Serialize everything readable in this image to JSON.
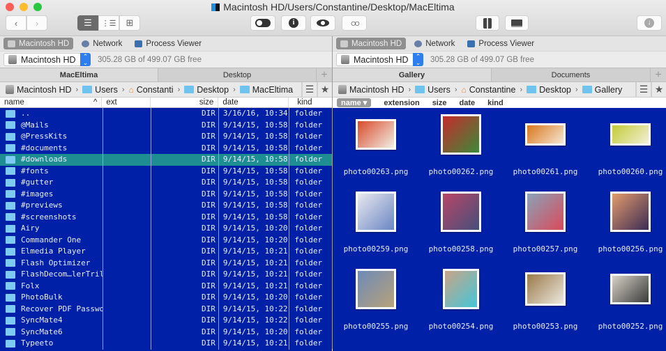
{
  "window": {
    "title": "Macintosh HD/Users/Constantine/Desktop/MacEltima",
    "traffic_lights": {
      "close": "#fc5f57",
      "minimize": "#fdbc2e",
      "zoom": "#28c840"
    }
  },
  "toolbar": {
    "back_icon": "chevron-left",
    "forward_icon": "chevron-right",
    "view_modes": [
      {
        "name": "list-view",
        "glyph": "☰",
        "active": true
      },
      {
        "name": "detail-view",
        "glyph": "⋮☰",
        "active": false
      },
      {
        "name": "grid-view",
        "glyph": "⊞",
        "active": false
      }
    ],
    "buttons": [
      {
        "name": "toggle-hidden",
        "glyph": "toggle"
      },
      {
        "name": "info",
        "glyph": "i"
      },
      {
        "name": "quick-look",
        "glyph": "eye"
      },
      {
        "name": "search",
        "glyph": "binoculars"
      },
      {
        "name": "archive",
        "glyph": "zip"
      },
      {
        "name": "network-share",
        "glyph": "network-folder"
      },
      {
        "name": "download",
        "glyph": "download"
      }
    ]
  },
  "colors": {
    "list_bg": "#0020a8",
    "selection": "#1f8e92",
    "accent": "#2f7ef0"
  },
  "left": {
    "devices": [
      {
        "label": "Macintosh HD",
        "active": true
      },
      {
        "label": "Network",
        "active": false
      },
      {
        "label": "Process Viewer",
        "active": false
      }
    ],
    "drive": {
      "label": "Macintosh HD",
      "free": "305.28 GB of 499.07 GB free"
    },
    "tabs": [
      {
        "label": "MacEltima",
        "active": true
      },
      {
        "label": "Desktop",
        "active": false
      }
    ],
    "tab_add": "+",
    "breadcrumb": [
      "Macintosh HD",
      "Users",
      "Constanti",
      "Desktop",
      "MacEltima"
    ],
    "columns": {
      "name": "name",
      "ext": "ext",
      "size": "size",
      "date": "date",
      "kind": "kind",
      "sort_indicator": "^"
    },
    "rows": [
      {
        "name": "..",
        "ext": "",
        "size": "DIR",
        "date": "3/16/16, 10:34",
        "kind": "folder"
      },
      {
        "name": "@Mails",
        "ext": "",
        "size": "DIR",
        "date": "9/14/15, 10:58",
        "kind": "folder"
      },
      {
        "name": "@PressKits",
        "ext": "",
        "size": "DIR",
        "date": "9/14/15, 10:58",
        "kind": "folder"
      },
      {
        "name": "#documents",
        "ext": "",
        "size": "DIR",
        "date": "9/14/15, 10:58",
        "kind": "folder"
      },
      {
        "name": "#downloads",
        "ext": "",
        "size": "DIR",
        "date": "9/14/15, 10:58",
        "kind": "folder",
        "selected": true
      },
      {
        "name": "#fonts",
        "ext": "",
        "size": "DIR",
        "date": "9/14/15, 10:58",
        "kind": "folder"
      },
      {
        "name": "#gutter",
        "ext": "",
        "size": "DIR",
        "date": "9/14/15, 10:58",
        "kind": "folder"
      },
      {
        "name": "#images",
        "ext": "",
        "size": "DIR",
        "date": "9/14/15, 10:58",
        "kind": "folder"
      },
      {
        "name": "#previews",
        "ext": "",
        "size": "DIR",
        "date": "9/14/15, 10:58",
        "kind": "folder"
      },
      {
        "name": "#screenshots",
        "ext": "",
        "size": "DIR",
        "date": "9/14/15, 10:58",
        "kind": "folder"
      },
      {
        "name": "Airy",
        "ext": "",
        "size": "DIR",
        "date": "9/14/15, 10:20",
        "kind": "folder"
      },
      {
        "name": "Commander One",
        "ext": "",
        "size": "DIR",
        "date": "9/14/15, 10:20",
        "kind": "folder"
      },
      {
        "name": "Elmedia Player",
        "ext": "",
        "size": "DIR",
        "date": "9/14/15, 10:21",
        "kind": "folder"
      },
      {
        "name": "Flash Optimizer",
        "ext": "",
        "size": "DIR",
        "date": "9/14/15, 10:21",
        "kind": "folder"
      },
      {
        "name": "FlashDecom…lerTrillix",
        "ext": "",
        "size": "DIR",
        "date": "9/14/15, 10:21",
        "kind": "folder"
      },
      {
        "name": "Folx",
        "ext": "",
        "size": "DIR",
        "date": "9/14/15, 10:21",
        "kind": "folder"
      },
      {
        "name": "PhotoBulk",
        "ext": "",
        "size": "DIR",
        "date": "9/14/15, 10:20",
        "kind": "folder"
      },
      {
        "name": "Recover PDF Password",
        "ext": "",
        "size": "DIR",
        "date": "9/14/15, 10:22",
        "kind": "folder"
      },
      {
        "name": "SyncMate4",
        "ext": "",
        "size": "DIR",
        "date": "9/14/15, 10:22",
        "kind": "folder"
      },
      {
        "name": "SyncMate6",
        "ext": "",
        "size": "DIR",
        "date": "9/14/15, 10:20",
        "kind": "folder"
      },
      {
        "name": "Typeeto",
        "ext": "",
        "size": "DIR",
        "date": "9/14/15, 10:21",
        "kind": "folder"
      }
    ]
  },
  "right": {
    "devices": [
      {
        "label": "Macintosh HD",
        "active": true
      },
      {
        "label": "Network",
        "active": false
      },
      {
        "label": "Process Viewer",
        "active": false
      }
    ],
    "drive": {
      "label": "Macintosh HD",
      "free": "305.28 GB of 499.07 GB free"
    },
    "tabs": [
      {
        "label": "Gallery",
        "active": true
      },
      {
        "label": "Documents",
        "active": false
      }
    ],
    "tab_add": "+",
    "breadcrumb": [
      "Macintosh HD",
      "Users",
      "Constantine",
      "Desktop",
      "Gallery"
    ],
    "sort_options": [
      {
        "label": "name ▾",
        "active": true
      },
      {
        "label": "extension",
        "active": false
      },
      {
        "label": "size",
        "active": false
      },
      {
        "label": "date",
        "active": false
      },
      {
        "label": "kind",
        "active": false
      }
    ],
    "items": [
      {
        "name": "photo00263.png",
        "colors": [
          "#d84a2a",
          "#f1efe6"
        ]
      },
      {
        "name": "photo00262.png",
        "colors": [
          "#c52b2b",
          "#3c8a3a"
        ]
      },
      {
        "name": "photo00261.png",
        "colors": [
          "#d9771d",
          "#f5e7d2"
        ]
      },
      {
        "name": "photo00260.png",
        "colors": [
          "#c3cc35",
          "#f3efd8"
        ]
      },
      {
        "name": "photo00259.png",
        "colors": [
          "#e9e9ee",
          "#6a86c4"
        ]
      },
      {
        "name": "photo00258.png",
        "colors": [
          "#b84668",
          "#444f7a"
        ]
      },
      {
        "name": "photo00257.png",
        "colors": [
          "#8aa2b8",
          "#d94a5a"
        ]
      },
      {
        "name": "photo00256.png",
        "colors": [
          "#e39b6c",
          "#3b2b55"
        ]
      },
      {
        "name": "photo00255.png",
        "colors": [
          "#6c8ab8",
          "#b9a27a"
        ]
      },
      {
        "name": "photo00254.png",
        "colors": [
          "#c8a488",
          "#44c6d8"
        ]
      },
      {
        "name": "photo00253.png",
        "colors": [
          "#9a7a4a",
          "#ece8df"
        ]
      },
      {
        "name": "photo00252.png",
        "colors": [
          "#d7d2c7",
          "#3a3a3a"
        ]
      }
    ]
  }
}
